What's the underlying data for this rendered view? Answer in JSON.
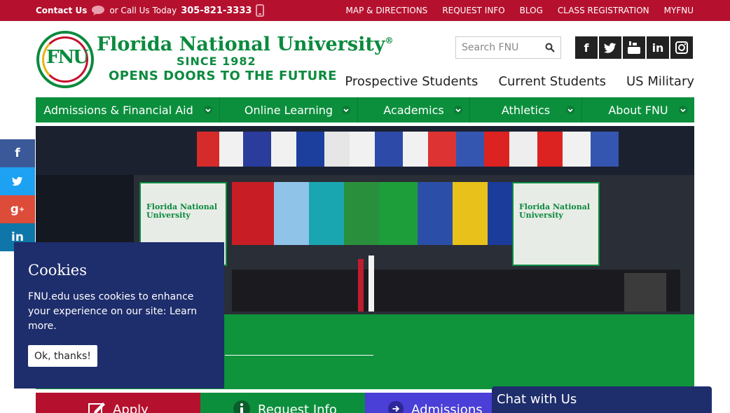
{
  "topbar": {
    "contact_label": "Contact Us",
    "call_label": "or Call Us Today",
    "phone": "305-821-3333",
    "links": [
      "MAP & DIRECTIONS",
      "REQUEST INFO",
      "BLOG",
      "CLASS REGISTRATION",
      "MYFNU"
    ]
  },
  "logo": {
    "seal_letters": "FNU",
    "name": "Florida National University",
    "registered": "®",
    "since": "SINCE 1982",
    "tagline": "OPENS DOORS TO THE FUTURE"
  },
  "search": {
    "placeholder": "Search FNU"
  },
  "social_top": [
    "facebook-icon",
    "twitter-icon",
    "youtube-icon",
    "linkedin-icon",
    "instagram-icon"
  ],
  "audience": [
    "Prospective Students",
    "Current Students",
    "US Military"
  ],
  "mainnav": [
    "Admissions & Financial Aid",
    "Online Learning",
    "Academics",
    "Athletics",
    "About FNU"
  ],
  "hero": {
    "banner_text": "Florida National University"
  },
  "share": [
    "facebook-icon",
    "twitter-icon",
    "google-plus-icon",
    "linkedin-icon"
  ],
  "cookie": {
    "title": "Cookies",
    "body": "FNU.edu uses cookies to enhance your experience on our site:",
    "link": "Learn more.",
    "button": "Ok, thanks!"
  },
  "cta": [
    "Apply",
    "Request Info",
    "Admissions In"
  ],
  "chat": {
    "label": "Chat with Us"
  },
  "colors": {
    "brand_red": "#b5112f",
    "brand_green": "#0c8f3d",
    "navy": "#1e2d6b"
  }
}
